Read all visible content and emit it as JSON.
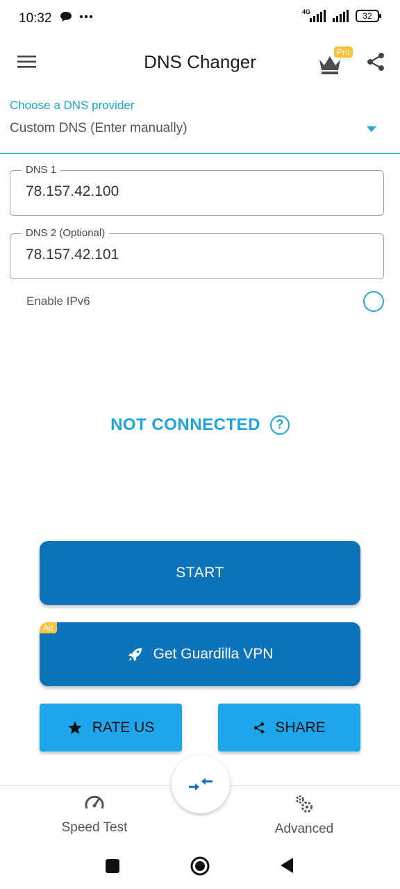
{
  "status_bar": {
    "time": "10:32",
    "network": "4G",
    "battery": "32"
  },
  "app_bar": {
    "title": "DNS Changer",
    "pro_badge": "Pro"
  },
  "provider": {
    "label": "Choose a DNS provider",
    "value": "Custom DNS (Enter manually)"
  },
  "dns1": {
    "label": "DNS 1",
    "value": "78.157.42.100"
  },
  "dns2": {
    "label": "DNS 2 (Optional)",
    "value": "78.157.42.101"
  },
  "ipv6": {
    "label": "Enable IPv6"
  },
  "connection": {
    "status": "NOT CONNECTED",
    "help": "?"
  },
  "buttons": {
    "start": "START",
    "ad_badge": "Ad",
    "vpn": "Get Guardilla VPN",
    "rate": "RATE US",
    "share": "SHARE"
  },
  "bottom_nav": {
    "speed_test": "Speed Test",
    "advanced": "Advanced"
  },
  "colors": {
    "primary": "#0d73ba",
    "accent": "#1aa3dc",
    "secondary_button": "#1ea6ec",
    "badge": "#f8c23b"
  }
}
